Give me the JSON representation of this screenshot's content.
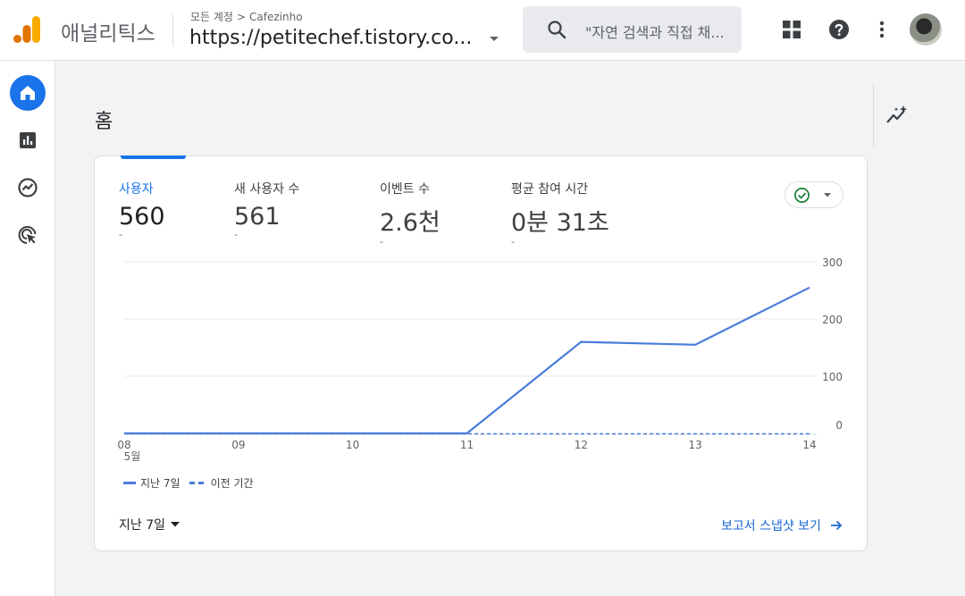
{
  "header": {
    "app_name": "애널리틱스",
    "breadcrumb": {
      "root": "모든 계정",
      "account": "Cafezinho"
    },
    "property_name": "https://petitechef.tistory.co...",
    "search_placeholder": "\"자연 검색과 직접 채..."
  },
  "icons": {
    "logo": "analytics-logo-icon",
    "search": "search-icon",
    "apps": "apps-grid-icon",
    "help": "help-icon",
    "more": "more-vert-icon",
    "nav": [
      "home-icon",
      "reports-icon",
      "explore-icon",
      "advertising-icon"
    ],
    "insights": "insights-icon",
    "compare": "check-circle-icon"
  },
  "colors": {
    "accent": "#1a73e8",
    "series": "#4a7ddb",
    "check": "#188038"
  },
  "page": {
    "title": "홈"
  },
  "metrics": [
    {
      "label": "사용자",
      "value": "560",
      "delta": "-",
      "active": true
    },
    {
      "label": "새 사용자 수",
      "value": "561",
      "delta": "-",
      "active": false
    },
    {
      "label": "이벤트 수",
      "value": "2.6천",
      "delta": "-",
      "active": false
    },
    {
      "label": "평균 참여 시간",
      "value": "0분 31초",
      "delta": "-",
      "active": false
    }
  ],
  "chart_data": {
    "type": "line",
    "categories": [
      "08",
      "09",
      "10",
      "11",
      "12",
      "13",
      "14"
    ],
    "month_label": "5월",
    "series": [
      {
        "name": "지난 7일",
        "values": [
          0,
          0,
          0,
          0,
          160,
          155,
          255
        ],
        "style": "solid"
      },
      {
        "name": "이전 기간",
        "values": [
          0,
          0,
          0,
          0,
          0,
          0,
          0
        ],
        "style": "dashed"
      }
    ],
    "y_ticks": [
      0,
      100,
      200,
      300
    ],
    "ylim": [
      0,
      300
    ],
    "y_axis_side": "right",
    "grid": true,
    "legend_position": "bottom-left"
  },
  "footer": {
    "date_range": "지난 7일",
    "report_link": "보고서 스냅샷 보기"
  }
}
